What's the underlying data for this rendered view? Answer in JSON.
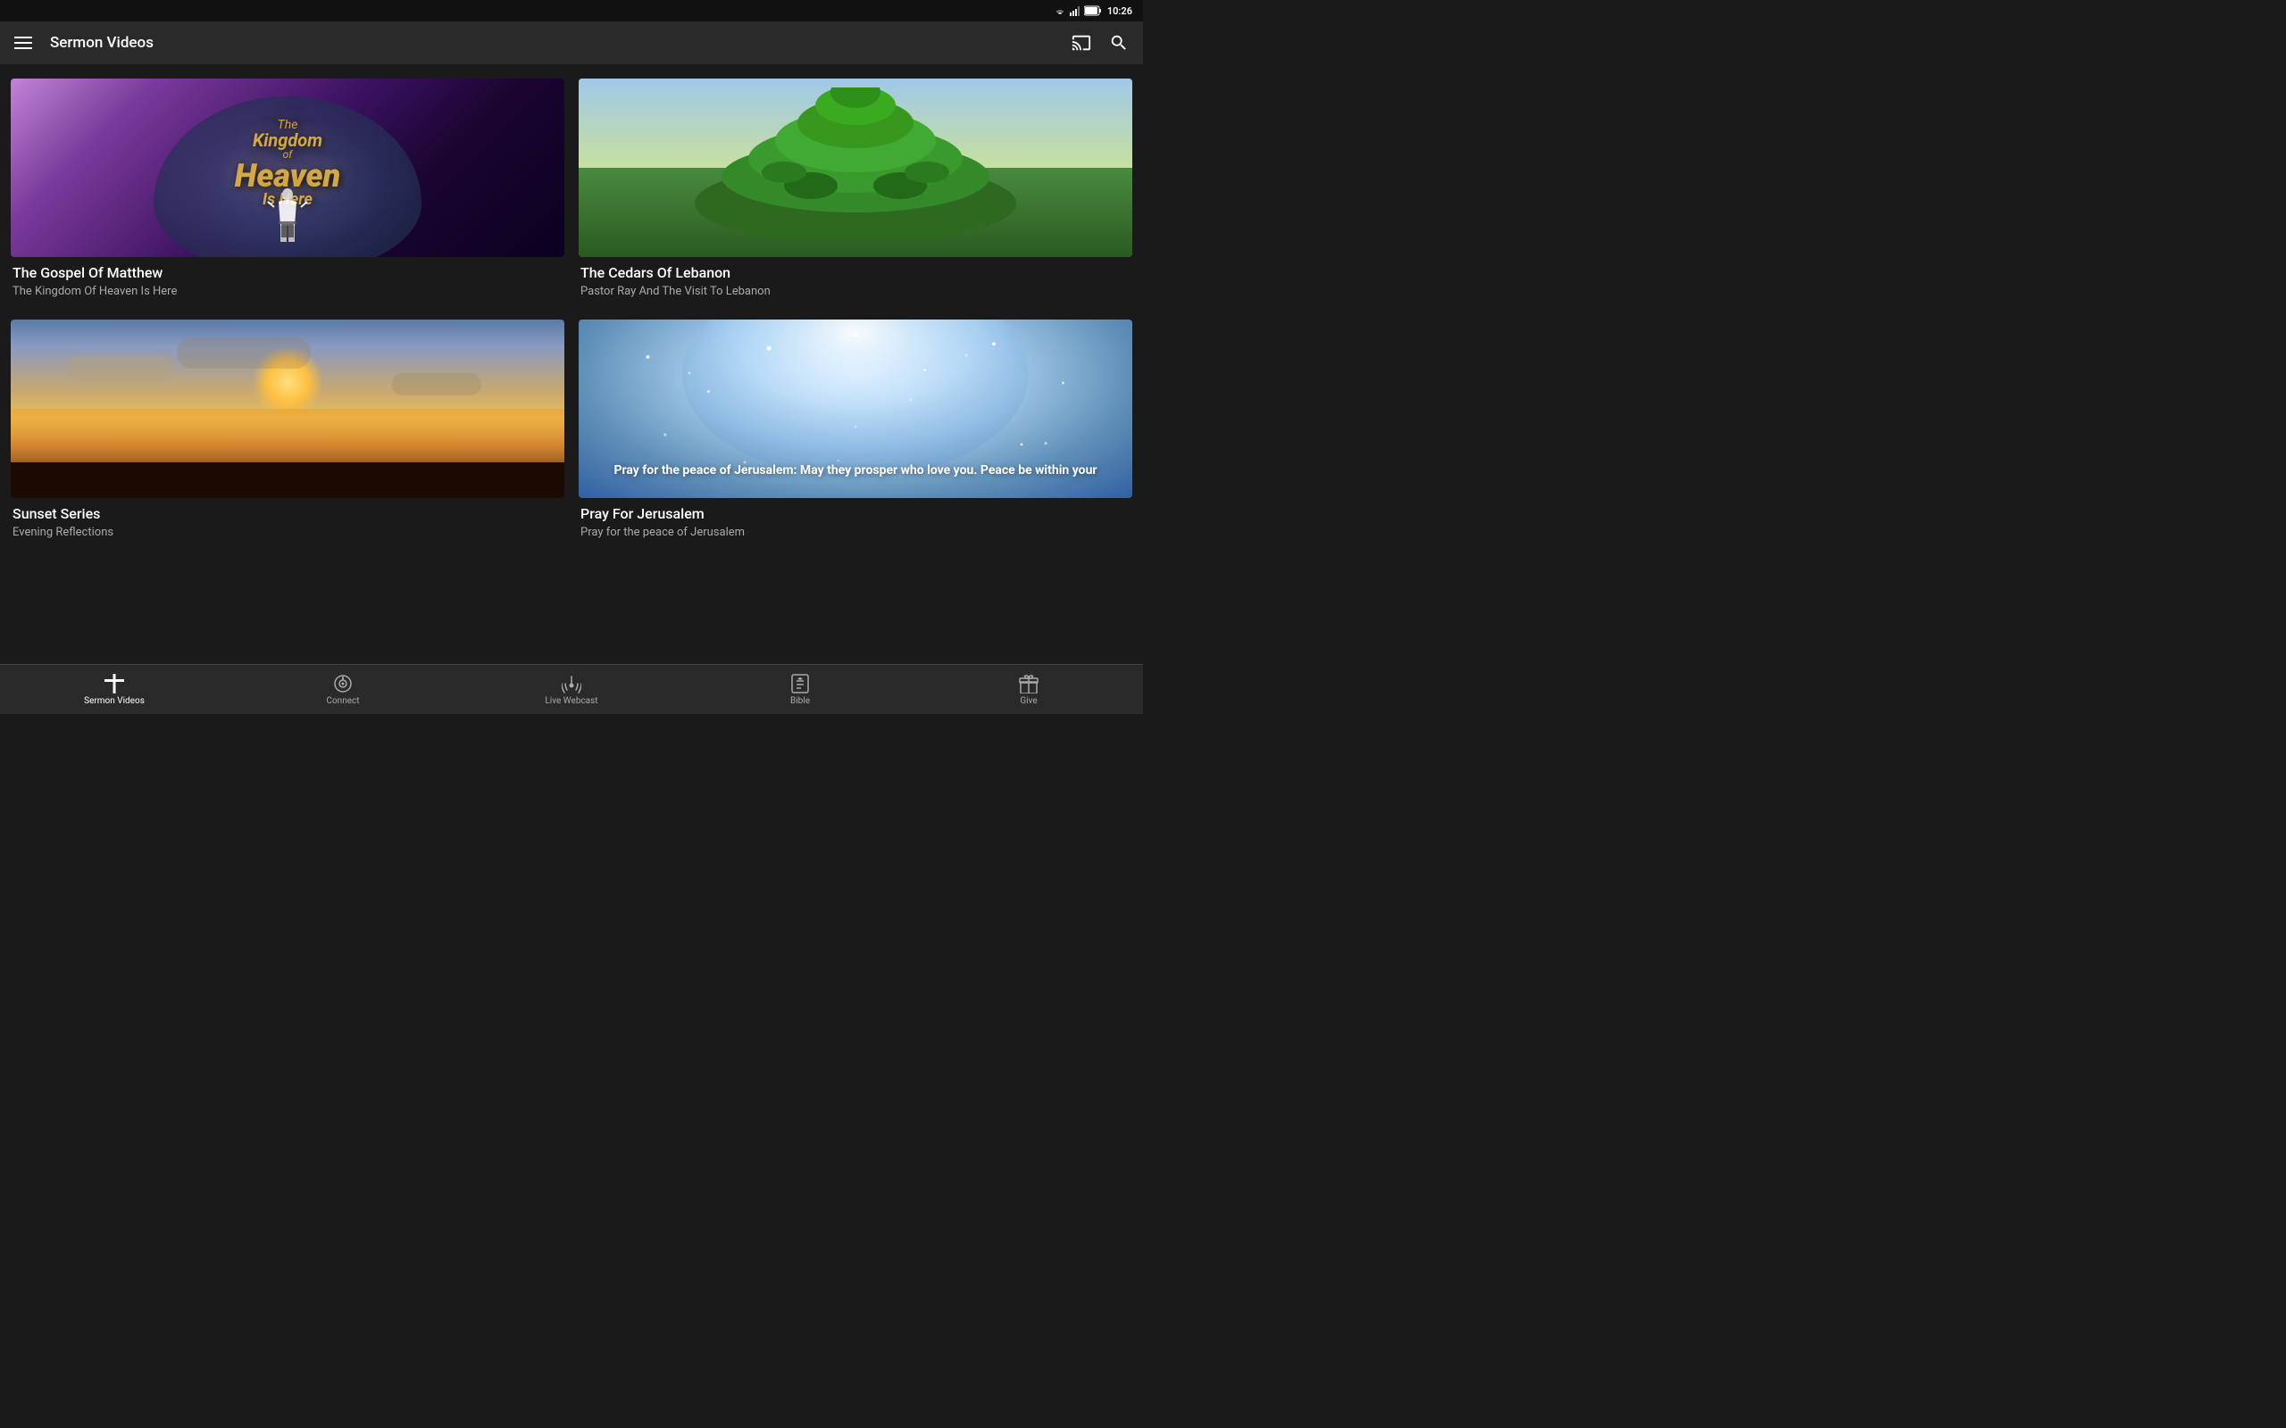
{
  "statusBar": {
    "time": "10:26"
  },
  "appBar": {
    "title": "Sermon Videos",
    "menuIcon": "hamburger-icon",
    "castIcon": "cast-icon",
    "searchIcon": "search-icon"
  },
  "videoCards": [
    {
      "id": "gospel-matthew",
      "title": "The Gospel Of Matthew",
      "subtitle": "The Kingdom Of Heaven Is Here",
      "thumbnailType": "gospel"
    },
    {
      "id": "cedars-lebanon",
      "title": "The Cedars Of Lebanon",
      "subtitle": "Pastor Ray And The Visit To Lebanon",
      "thumbnailType": "cedar"
    },
    {
      "id": "sunset-series",
      "title": "Sunset Series",
      "subtitle": "Evening Reflections",
      "thumbnailType": "sunset"
    },
    {
      "id": "pray-jerusalem",
      "title": "Pray For Jerusalem",
      "subtitle": "Pray for the peace of Jerusalem",
      "thumbnailType": "jerusalem",
      "prayText": "Pray for the peace of Jerusalem:\nMay they prosper who love you. Peace be within your"
    }
  ],
  "bottomNav": [
    {
      "id": "sermon-videos",
      "label": "Sermon Videos",
      "icon": "cross-icon",
      "active": true
    },
    {
      "id": "connect",
      "label": "Connect",
      "icon": "connect-icon",
      "active": false
    },
    {
      "id": "live-webcast",
      "label": "Live Webcast",
      "icon": "broadcast-icon",
      "active": false
    },
    {
      "id": "bible",
      "label": "Bible",
      "icon": "bible-icon",
      "active": false
    },
    {
      "id": "give",
      "label": "Give",
      "icon": "gift-icon",
      "active": false
    }
  ]
}
